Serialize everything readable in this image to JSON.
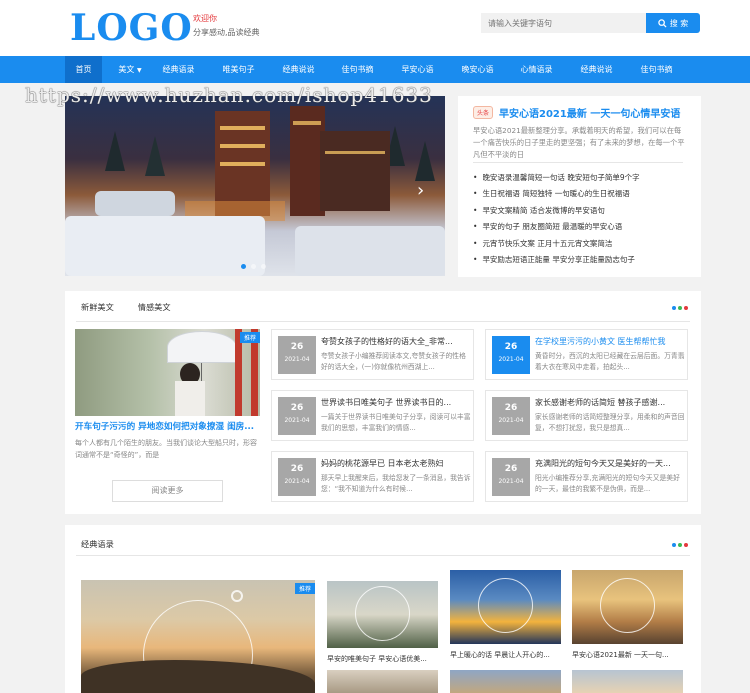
{
  "header": {
    "logo": "LOGO",
    "tagline_line1": "欢迎你",
    "tagline_line2": "分享感动,品读经典",
    "search_placeholder": "请输入关键字语句",
    "search_button": "搜 索"
  },
  "nav": {
    "items": [
      "首页",
      "美文",
      "经典语录",
      "唯美句子",
      "经典说说",
      "佳句书摘",
      "早安心语",
      "晚安心语",
      "心情语录",
      "经典说说",
      "佳句书摘"
    ]
  },
  "watermark": "https://www.huzhan.com/ishop41633",
  "featured_top": {
    "badge": "头条",
    "title": "早安心语2021最新 一天一句心情早安语",
    "desc": "早安心语2021最新整理分享。承载着明天的希望，我们可以在每一个痛苦快乐的日子里走的更坚强；有了未来的梦想，在每一个平凡但不平淡的日",
    "list": [
      "晚安语录温馨简短一句话 晚安短句子简单9个字",
      "生日祝福语 简短独特 一句暖心的生日祝福语",
      "早安文案精简 适合发微博的早安语句",
      "早安的句子 朋友圈简短 最温暖的早安心语",
      "元宵节快乐文案 正月十五元宵文案简洁",
      "早安励志短语正能量 早安分享正能量励志句子"
    ]
  },
  "panel1": {
    "tabs": [
      "新鲜美文",
      "情感美文"
    ],
    "featured": {
      "badge": "推荐",
      "title": "开车句子污污的 异地恋如何把对象撩湿 闺房...",
      "desc": "每个人都有几个陌生的朋友。当我们谈论大型船只时，形容词通常不是“奇怪的”，而是",
      "more": "阅读更多"
    },
    "cards": [
      {
        "day": "26",
        "month": "2021-04",
        "title": "夸赞女孩子的性格好的语大全_非常...",
        "desc": "夸赞女孩子小编推荐阅读本文,夸赞女孩子的性格好的话大全，(一)你就像杭州西湖上...",
        "highlight": false
      },
      {
        "day": "26",
        "month": "2021-04",
        "title": "在学校里污污的小黄文 医生帮帮忙我",
        "desc": "黄昏时分，西沉的太阳已经藏在云层后面。万青翡着大衣在寒风中走着，拍起头...",
        "highlight": true
      },
      {
        "day": "26",
        "month": "2021-04",
        "title": "世界读书日唯美句子 世界读书日的...",
        "desc": "一篇关于世界读书日唯美句子分享，阅读可以丰富我们的思想，丰富我们的情感...",
        "highlight": false
      },
      {
        "day": "26",
        "month": "2021-04",
        "title": "家长感谢老师的话简短 替孩子感谢...",
        "desc": "家长感谢老师的话简短整理分享，用柔和的声音回复，不想打扰您，我只是想真...",
        "highlight": false
      },
      {
        "day": "26",
        "month": "2021-04",
        "title": "妈妈的桃花源早已 日本老太老熟妇",
        "desc": "那天早上我醒来后，我给您发了一条消息，我告诉您：“我不知道为什么有时候...",
        "highlight": false
      },
      {
        "day": "26",
        "month": "2021-04",
        "title": "充满阳光的短句今天又是美好的一天...",
        "desc": "阳光小编推荐分享,充满阳光的短句今天又是美好的一天，最佳的我繁不是伪俱，而是...",
        "highlight": false
      }
    ]
  },
  "panel2": {
    "title": "经典语录",
    "badge": "推荐",
    "thumbs": [
      {
        "caption": "早安的唯美句子 早安心语优美..."
      },
      {
        "caption": "早上暖心的话 早晨让人开心的..."
      },
      {
        "caption": "早安心语2021最新 一天一句..."
      }
    ]
  },
  "colors": {
    "brand": "#1a8cef",
    "accent_red": "#e4393c",
    "date_gray": "#a7a7a7"
  }
}
